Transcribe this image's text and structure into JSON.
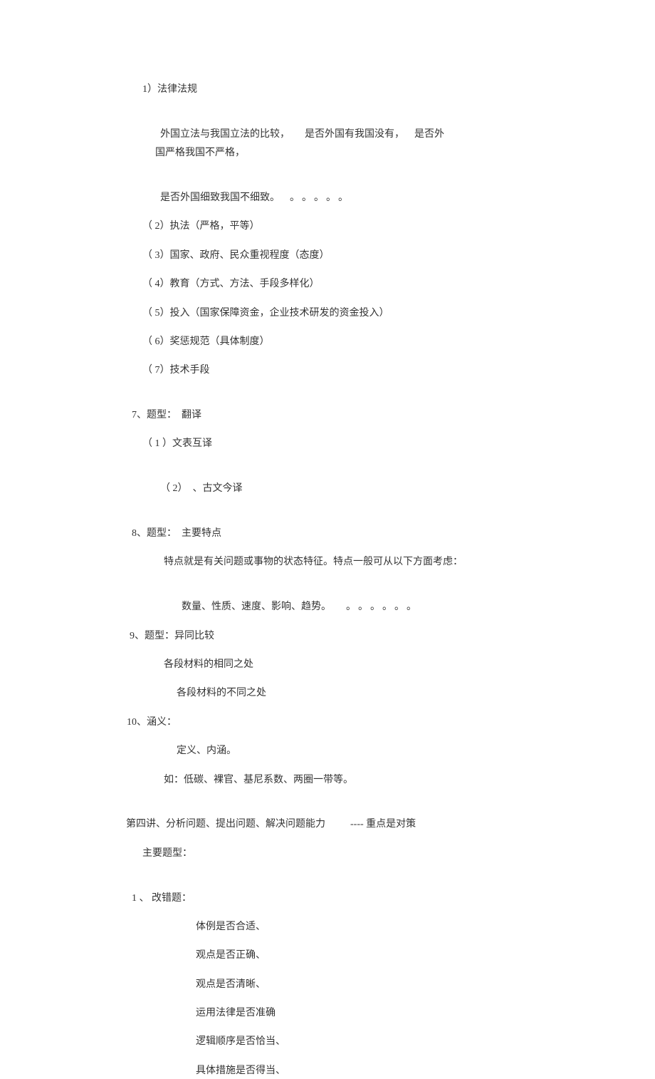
{
  "p1": "1）法律法规",
  "p2_a": "外国立法与我国立法的比较，",
  "p2_b": "是否外国有我国没有，",
  "p2_c": "是否外",
  "p2_d": "国严格我国不严格，",
  "p3_a": "是否外国细致我国不细致。",
  "p3_b": "。。。。。",
  "p4": "（ 2）执法（严格，平等）",
  "p5": "（ 3）国家、政府、民众重视程度（态度）",
  "p6": "（ 4）教育（方式、方法、手段多样化）",
  "p7": "（ 5）投入（国家保障资金，企业技术研发的资金投入）",
  "p8": "（ 6）奖惩规范（具体制度）",
  "p9": "（ 7）技术手段",
  "p10": "7、题型：",
  "p10b": "翻译",
  "p11": "（ 1 ）文表互译",
  "p12": "（ 2）",
  "p12b": "、古文今译",
  "p13": "8、题型：",
  "p13b": "主要特点",
  "p14": "特点就是有关问题或事物的状态特征。特点一般可从以下方面考虑：",
  "p15_a": "数量、性质、速度、影响、趋势。",
  "p15_b": "。。。。。。",
  "p16": "9、题型：异同比较",
  "p17": "各段材料的相同之处",
  "p18": "各段材料的不同之处",
  "p19": "10、涵义：",
  "p20": "定义、内涵。",
  "p21": "如：低碳、裸官、基尼系数、两圈一带等。",
  "p22_a": "第四讲、分析问题、提出问题、解决问题能力",
  "p22_b": "----",
  "p22_c": "重点是对策",
  "p23": "主要题型：",
  "p24": "1 、",
  "p24b": "改错题：",
  "p25": "体例是否合适、",
  "p26": "观点是否正确、",
  "p27": "观点是否清晰、",
  "p28": "运用法律是否准确",
  "p29": "逻辑顺序是否恰当、",
  "p30": "具体措施是否得当、"
}
